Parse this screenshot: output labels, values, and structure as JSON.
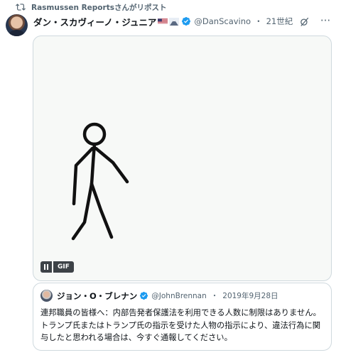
{
  "repost": {
    "text": "Rasmussen Reportsさんがリポスト"
  },
  "post": {
    "display_name": "ダン・スカヴィーノ・ジュニア",
    "emojis": [
      "us-flag",
      "mount-fuji"
    ],
    "handle": "@DanScavino",
    "separator": "・",
    "time": "21世紀"
  },
  "media": {
    "type": "gif",
    "badge": "GIF",
    "pause_icon": "pause-icon"
  },
  "quote": {
    "display_name": "ジョン・O・ブレナン",
    "handle": "@JohnBrennan",
    "separator": "・",
    "date": "2019年9月28日",
    "text": "連邦職員の皆様へ：内部告発者保護法を利用できる人数に制限はありません。トランプ氏またはトランプ氏の指示を受けた人物の指示により、違法行為に関与したと思われる場合は、今すぐ通報してください。"
  },
  "colors": {
    "verified": "#1d9bf0",
    "secondary_text": "#536471",
    "border": "#cfd9de",
    "gif_badge_bg": "#3d4247"
  },
  "icons": [
    "repost-icon",
    "verified-badge-icon",
    "grok-icon",
    "more-icon",
    "pause-icon"
  ]
}
